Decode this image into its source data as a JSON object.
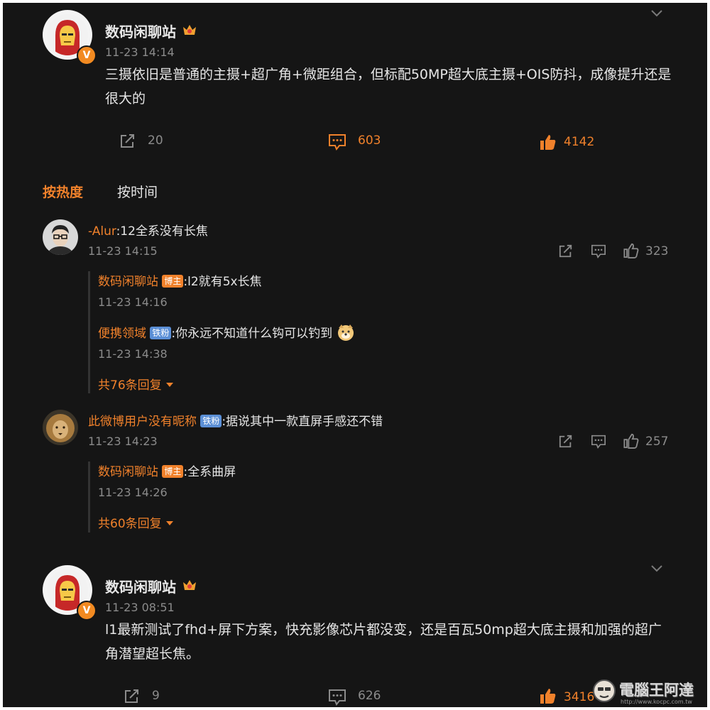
{
  "post1": {
    "author": "数码闲聊站",
    "time": "11-23 14:14",
    "content": "三摄依旧是普通的主摄+超广角+微距组合，但标配50MP超大底主摄+OIS防抖，成像提升还是很大的",
    "share_count": "20",
    "comment_count": "603",
    "like_count": "4142"
  },
  "sort_tabs": {
    "hot": "按热度",
    "time": "按时间"
  },
  "comments": [
    {
      "user": "-Alur",
      "text": ":12全系没有长焦",
      "time": "11-23 14:15",
      "likes": "323",
      "replies": [
        {
          "user": "数码闲聊站",
          "tag": "博主",
          "text": ":l2就有5x长焦",
          "time": "11-23 14:16"
        },
        {
          "user": "便携领域",
          "tag": "铁粉",
          "text": ":你永远不知道什么钩可以钓到",
          "time": "11-23 14:38"
        }
      ],
      "more": "共76条回复"
    },
    {
      "user": "此微博用户没有昵称",
      "tag": "铁粉",
      "text": ":据说其中一款直屏手感还不错",
      "time": "11-23 14:23",
      "likes": "257",
      "replies": [
        {
          "user": "数码闲聊站",
          "tag": "博主",
          "text": ":全系曲屏",
          "time": "11-23 14:26"
        }
      ],
      "more": "共60条回复"
    }
  ],
  "post2": {
    "author": "数码闲聊站",
    "time": "11-23 08:51",
    "content": "l1最新测试了fhd+屏下方案，快充影像芯片都没变，还是百瓦50mp超大底主摄和加强的超广角潜望超长焦。",
    "share_count": "9",
    "comment_count": "626",
    "like_count": "3416"
  },
  "verified_badge": "V",
  "watermark": {
    "text": "電腦王阿達",
    "url": "http://www.kocpc.com.tw"
  },
  "colors": {
    "accent": "#f0812b",
    "background": "#151515",
    "text": "#e6e6e6",
    "muted": "#8b8b8b"
  }
}
